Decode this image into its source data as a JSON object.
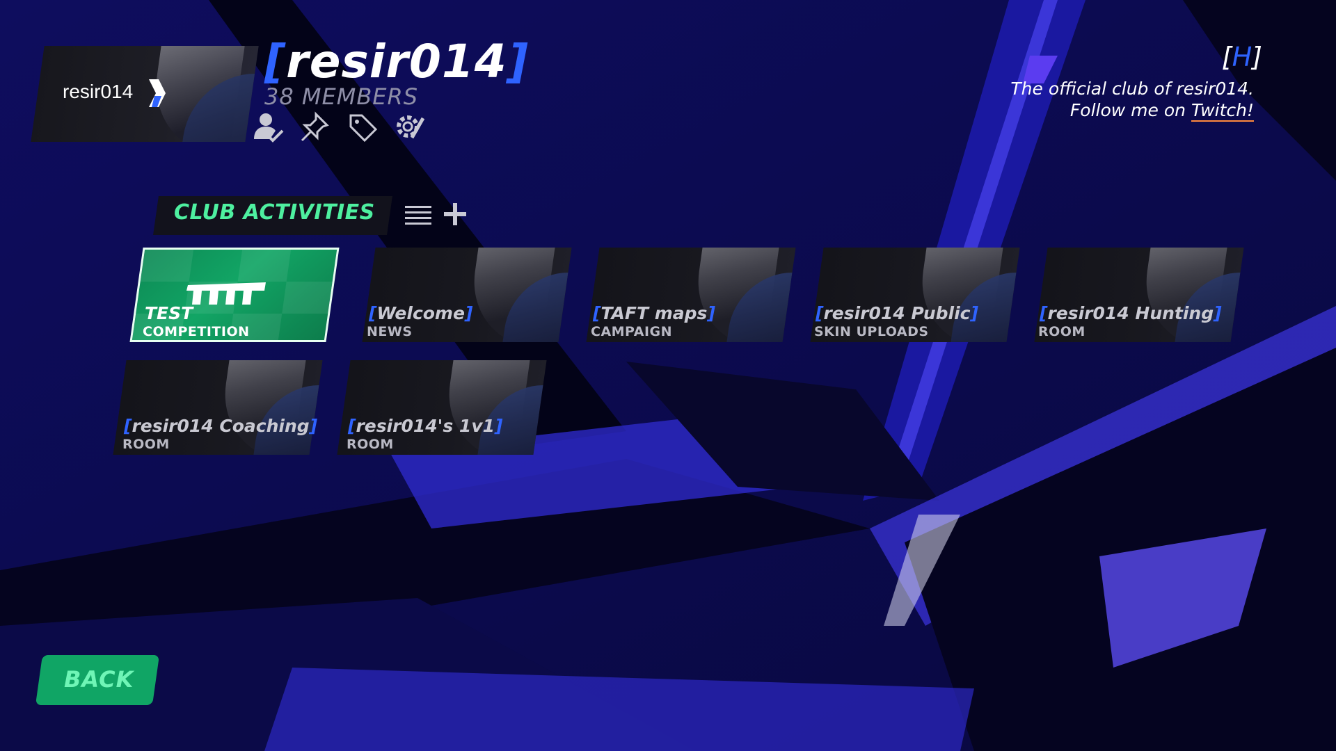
{
  "club": {
    "badge_text": "resir014",
    "name_bracket_open": "[",
    "name": "resir014",
    "name_bracket_close": "]",
    "member_count": "38 MEMBERS",
    "tag_open": "[",
    "tag_letter": "H",
    "tag_close": "]",
    "description_line1": "The official club of resir014.",
    "description_line2_prefix": "Follow me on ",
    "description_link": "Twitch!",
    "header_icons": [
      "user-check-icon",
      "pin-icon",
      "tag-icon",
      "gear-edit-icon"
    ]
  },
  "activities": {
    "title": "CLUB ACTIVITIES",
    "list_icon": "list-icon",
    "add_icon": "plus-icon",
    "items": [
      {
        "title": "TEST",
        "type": "COMPETITION",
        "featured": true
      },
      {
        "title": "Welcome",
        "type": "NEWS"
      },
      {
        "title": "TAFT maps",
        "type": "CAMPAIGN"
      },
      {
        "title": "resir014 Public",
        "type": "SKIN UPLOADS"
      },
      {
        "title": "resir014 Hunting",
        "type": "ROOM"
      },
      {
        "title": "resir014 Coaching",
        "type": "ROOM"
      },
      {
        "title": "resir014's 1v1",
        "type": "ROOM"
      }
    ]
  },
  "back_button": {
    "label": "BACK"
  },
  "colors": {
    "background": "#0c0b55",
    "accent_green": "#4ef0a0",
    "bracket_blue": "#2f63ff",
    "button_green": "#10a565"
  }
}
